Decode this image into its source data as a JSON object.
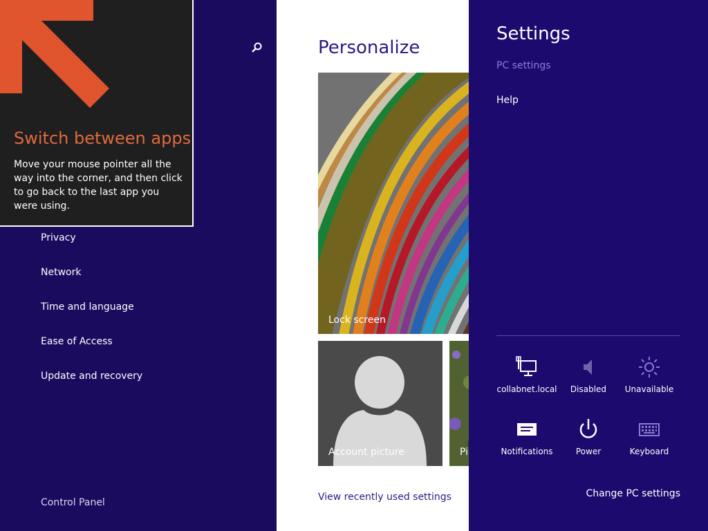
{
  "left_nav": {
    "items": [
      {
        "label": "Privacy"
      },
      {
        "label": "Network"
      },
      {
        "label": "Time and language"
      },
      {
        "label": "Ease of Access"
      },
      {
        "label": "Update and recovery"
      }
    ],
    "control_panel": "Control Panel",
    "search_icon": "search-icon"
  },
  "tip": {
    "title": "Switch between apps",
    "body": "Move your mouse pointer all the way into the corner, and then click to go back to the last app you were using.",
    "arrow_color": "#e0552d"
  },
  "personalize": {
    "title": "Personalize",
    "tiles": {
      "lock_screen": "Lock screen",
      "account_picture": "Account picture",
      "picture_partial": "Pi"
    },
    "view_recent": "View recently used settings"
  },
  "charm": {
    "title": "Settings",
    "links": {
      "pc_settings": "PC settings",
      "help": "Help"
    },
    "quick_settings": [
      {
        "label": "collabnet.local",
        "icon": "network-icon"
      },
      {
        "label": "Disabled",
        "icon": "volume-icon"
      },
      {
        "label": "Unavailable",
        "icon": "brightness-icon"
      },
      {
        "label": "Notifications",
        "icon": "notifications-icon"
      },
      {
        "label": "Power",
        "icon": "power-icon"
      },
      {
        "label": "Keyboard",
        "icon": "keyboard-icon"
      }
    ],
    "change_pc_settings": "Change PC settings"
  },
  "colors": {
    "nav_bg": "#1b0b5f",
    "charm_bg": "#1c0a6e",
    "accent_text": "#2b1a86",
    "tip_title": "#e06a3c"
  }
}
